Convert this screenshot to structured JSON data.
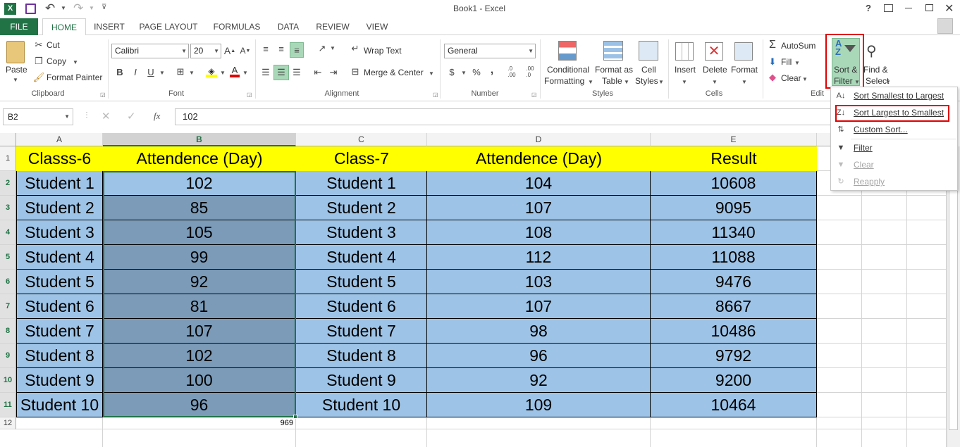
{
  "title": "Book1 - Excel",
  "tabs": [
    "FILE",
    "HOME",
    "INSERT",
    "PAGE LAYOUT",
    "FORMULAS",
    "DATA",
    "REVIEW",
    "VIEW"
  ],
  "clipboard": {
    "paste": "Paste",
    "cut": "Cut",
    "copy": "Copy",
    "format_painter": "Format Painter",
    "group": "Clipboard"
  },
  "font": {
    "name": "Calibri",
    "size": "20",
    "bold": "B",
    "italic": "I",
    "underline": "U",
    "group": "Font"
  },
  "alignment": {
    "wrap": "Wrap Text",
    "merge": "Merge & Center",
    "group": "Alignment"
  },
  "number": {
    "format": "General",
    "currency": "$",
    "percent": "%",
    "comma": ",",
    "group": "Number"
  },
  "styles": {
    "cond1": "Conditional",
    "cond2": "Formatting",
    "fat1": "Format as",
    "fat2": "Table",
    "cs1": "Cell",
    "cs2": "Styles",
    "group": "Styles"
  },
  "cells": {
    "insert": "Insert",
    "delete": "Delete",
    "format": "Format",
    "group": "Cells"
  },
  "editing": {
    "autosum": "AutoSum",
    "fill": "Fill",
    "clear": "Clear",
    "sort1": "Sort &",
    "sort2": "Filter",
    "find1": "Find &",
    "find2": "Select",
    "group": "Edit"
  },
  "formula_bar": {
    "name_box": "B2",
    "fx": "fx",
    "value": "102"
  },
  "columns": [
    "A",
    "B",
    "C",
    "D",
    "E"
  ],
  "rows": [
    "1",
    "2",
    "3",
    "4",
    "5",
    "6",
    "7",
    "8",
    "9",
    "10",
    "11",
    "12"
  ],
  "headers": [
    "Classs-6",
    "Attendence (Day)",
    "Class-7",
    "Attendence (Day)",
    "Result"
  ],
  "data": [
    [
      "Student 1",
      "102",
      "Student 1",
      "104",
      "10608"
    ],
    [
      "Student 2",
      "85",
      "Student 2",
      "107",
      "9095"
    ],
    [
      "Student 3",
      "105",
      "Student 3",
      "108",
      "11340"
    ],
    [
      "Student 4",
      "99",
      "Student 4",
      "112",
      "11088"
    ],
    [
      "Student 5",
      "92",
      "Student 5",
      "103",
      "9476"
    ],
    [
      "Student 6",
      "81",
      "Student 6",
      "107",
      "8667"
    ],
    [
      "Student 7",
      "107",
      "Student 7",
      "98",
      "10486"
    ],
    [
      "Student 8",
      "102",
      "Student 8",
      "96",
      "9792"
    ],
    [
      "Student 9",
      "100",
      "Student 9",
      "92",
      "9200"
    ],
    [
      "Student 10",
      "96",
      "Student 10",
      "109",
      "10464"
    ]
  ],
  "sum_b12": "969",
  "menu": {
    "sort_asc": "Sort Smallest to Largest",
    "sort_desc": "Sort Largest to Smallest",
    "custom": "Custom Sort...",
    "filter": "Filter",
    "clear": "Clear",
    "reapply": "Reapply"
  },
  "colors": {
    "header_fill": "#ffff00",
    "cell_fill": "#9dc3e6",
    "selected_fill": "#7b9bb8",
    "excel_green": "#217346",
    "highlight_red": "#e00000"
  }
}
